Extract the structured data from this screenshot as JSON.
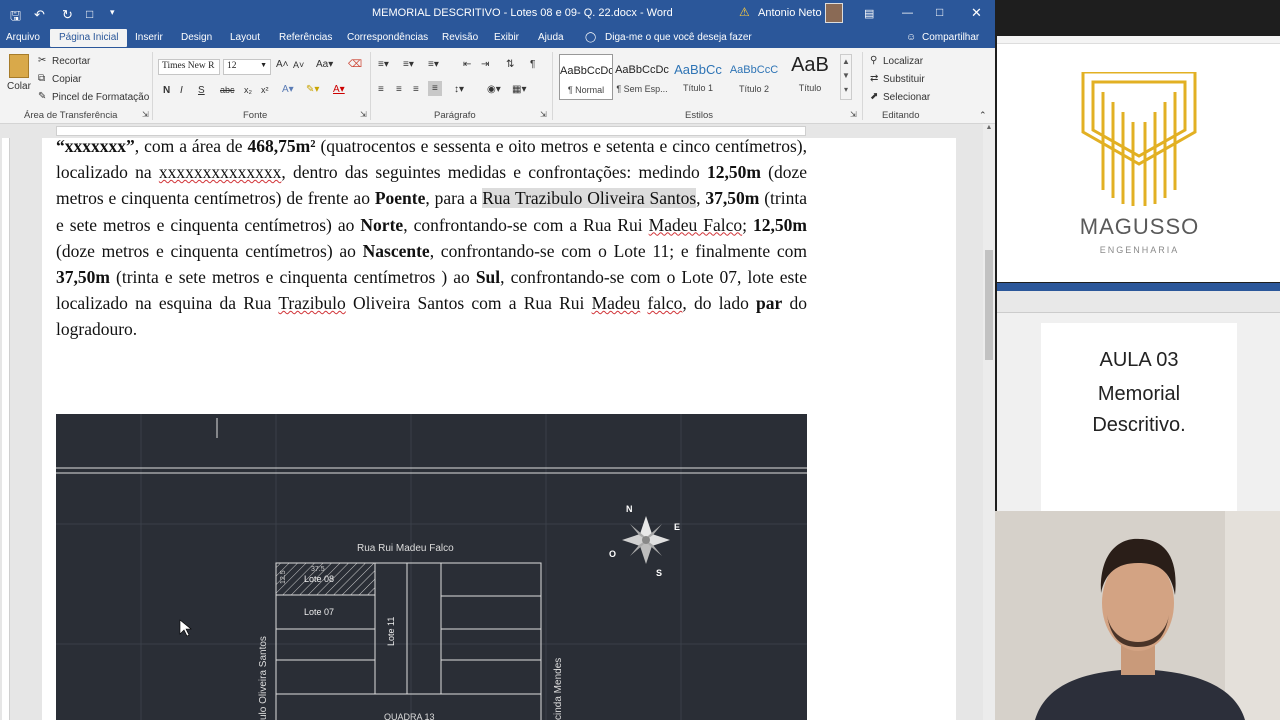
{
  "window": {
    "title": "MEMORIAL DESCRITIVO - Lotes 08 e 09- Q. 22.docx  -  Word",
    "user": "Antonio Neto"
  },
  "tabs": [
    {
      "label": "Arquivo"
    },
    {
      "label": "Página Inicial"
    },
    {
      "label": "Inserir"
    },
    {
      "label": "Design"
    },
    {
      "label": "Layout"
    },
    {
      "label": "Referências"
    },
    {
      "label": "Correspondências"
    },
    {
      "label": "Revisão"
    },
    {
      "label": "Exibir"
    },
    {
      "label": "Ajuda"
    },
    {
      "label": "Diga-me o que você deseja fazer"
    }
  ],
  "share_label": "Compartilhar",
  "clipboard": {
    "paste": "Colar",
    "cut": "Recortar",
    "copy": "Copiar",
    "format_painter": "Pincel de Formatação",
    "group": "Área de Transferência"
  },
  "font": {
    "family": "Times New R",
    "size": "12",
    "group": "Fonte"
  },
  "paragraph": {
    "group": "Parágrafo"
  },
  "styles": {
    "group": "Estilos",
    "items": [
      {
        "preview": "AaBbCcDc",
        "name": "¶ Normal"
      },
      {
        "preview": "AaBbCcDc",
        "name": "¶ Sem Esp..."
      },
      {
        "preview": "AaBbCc",
        "name": "Título 1"
      },
      {
        "preview": "AaBbCcC",
        "name": "Título 2"
      },
      {
        "preview": "AaB",
        "name": "Título"
      }
    ]
  },
  "editing": {
    "find": "Localizar",
    "replace": "Substituir",
    "select": "Selecionar",
    "group": "Editando"
  },
  "document": {
    "p1": "“xxxxxxx”",
    "p2": ", com a área de ",
    "p3": "468,75m²",
    "p4": " (quatrocentos e sessenta e oito metros e setenta e cinco centímetros), localizado na ",
    "p5": "xxxxxxxxxxxxxx",
    "p6": ", dentro das seguintes medidas e confrontações: medindo ",
    "p7": "12,50m",
    "p8": " (doze metros e cinquenta centímetros) de frente ao ",
    "p9": "Poente",
    "p10": ", para a ",
    "p11": "Rua Trazibulo Oliveira Santos",
    "p12": ", ",
    "p13": "37,50m",
    "p14": " (trinta e sete metros e cinquenta centímetros) ao ",
    "p15": "Norte",
    "p16": ", confrontando-se com a Rua Rui ",
    "p17": "Madeu Falco",
    "p18": "; ",
    "p19": "12,50m",
    "p20": " (doze metros e cinquenta centímetros) ao ",
    "p21": "Nascente",
    "p22": ", confrontando-se com o Lote 11; e finalmente com ",
    "p23": "37,50m",
    "p24": " (trinta e sete metros e cinquenta centímetros ) ao ",
    "p25": "Sul",
    "p26": ", confrontando-se com o Lote 07, lote este localizado na esquina da Rua ",
    "p27": "Trazibulo",
    "p28": " Oliveira Santos com a Rua Rui ",
    "p29": "Madeu",
    "p30": " ",
    "p31": "falco",
    "p32": ", do lado ",
    "p33": "par",
    "p34": " do logradouro."
  },
  "cad": {
    "street_top": "Rua Rui Madeu Falco",
    "street_left": "ulo Oliveira Santos",
    "street_right": "cinda Mendes",
    "lot8": "Lote 08",
    "lot7": "Lote 07",
    "lot11": "Lote 11",
    "dim_top": "37.5",
    "dim_side": "12.5",
    "block": "QUADRA 13",
    "compass": {
      "n": "N",
      "e": "E",
      "s": "S",
      "o": "O"
    }
  },
  "side": {
    "logo": "MAGUSSO",
    "logo_sub": "ENGENHARIA",
    "lesson": "AULA 03",
    "topic1": "Memorial",
    "topic2": "Descritivo."
  },
  "colors": {
    "word_blue": "#2b579a",
    "cad_bg": "#2a2e36",
    "logo_gold": "#e2b023"
  }
}
